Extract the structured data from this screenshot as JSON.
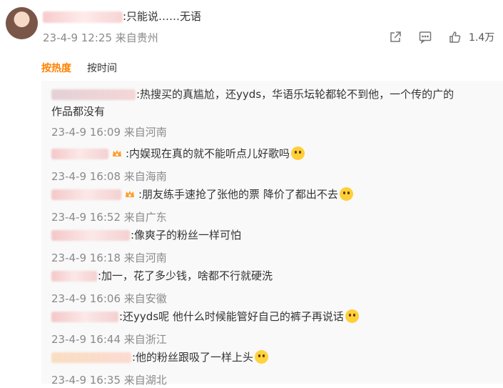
{
  "top_comment": {
    "text": ":只能说……无语",
    "time": "23-4-9 12:25",
    "location": "来自贵州",
    "like_count": "1.4万"
  },
  "sort_tabs": {
    "hot": "按热度",
    "time": "按时间"
  },
  "replies": [
    {
      "text": ":热搜买的真尴尬，还yyds，华语乐坛轮都轮不到他，一个传的广的",
      "text2": "作品都没有",
      "time": "23-4-9 16:09",
      "location": "来自河南",
      "name_prefix": "lily",
      "name_suffix": "4"
    },
    {
      "text": ":内娱现在真的就不能听点儿好歌吗",
      "time": "23-4-9 16:08",
      "location": "来自海南"
    },
    {
      "text": ":朋友练手速抢了张他的票 降价了都出不去",
      "time": "23-4-9 16:52",
      "location": "来自广东"
    },
    {
      "text": ":像爽子的粉丝一样可怕",
      "time": "23-4-9 16:18",
      "location": "来自河南"
    },
    {
      "text": ":加一，花了多少钱，啥都不行就硬洗",
      "time": "23-4-9 16:06",
      "location": "来自安徽"
    },
    {
      "text": ":还yyds呢 他什么时候能管好自己的裤子再说话",
      "time": "23-4-9 16:44",
      "location": "来自浙江",
      "name_suffix": "9"
    },
    {
      "text": ":他的粉丝跟吸了一样上头",
      "time": "23-4-9 16:35",
      "location": "来自湖北"
    }
  ],
  "icons": {
    "share": "share-icon",
    "comment": "comment-icon",
    "like": "thumbs-up-icon",
    "vip": "crown-badge-icon"
  },
  "colors": {
    "accent": "#ff8200",
    "meta": "#8a8a8a",
    "reply_bg": "#f9f9f9"
  }
}
